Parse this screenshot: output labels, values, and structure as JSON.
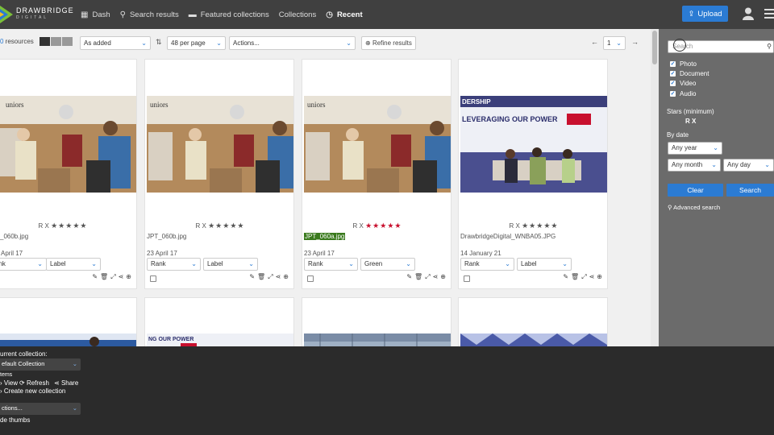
{
  "header": {
    "logo_text": "DRAWBRIDGE",
    "logo_sub": "DIGITAL",
    "nav": [
      {
        "label": "Dash",
        "icon": "grid-icon"
      },
      {
        "label": "Search results",
        "icon": "search-icon"
      },
      {
        "label": "Featured collections",
        "icon": "folder-icon"
      },
      {
        "label": "Collections",
        "icon": ""
      },
      {
        "label": "Recent",
        "icon": "clock-icon"
      }
    ],
    "upload_label": "Upload"
  },
  "toolbar": {
    "resource_count": "0",
    "resource_label": " resources",
    "sort_select": "As added",
    "per_page_select": "48 per page",
    "actions_select": "Actions...",
    "refine_label": "Refine results",
    "page_number": "1"
  },
  "cards": [
    {
      "rating_prefix": "R X",
      "filename": "_060b.jpg",
      "date": "April 17",
      "rank": "ank",
      "label": "Label",
      "highlight": false,
      "red_stars": false
    },
    {
      "rating_prefix": "R X",
      "filename": "JPT_060b.jpg",
      "date": "23 April 17",
      "rank": "Rank",
      "label": "Label",
      "highlight": false,
      "red_stars": false
    },
    {
      "rating_prefix": "R X",
      "filename": "JPT_060a.jpg",
      "date": "23 April 17",
      "rank": "Rank",
      "label": "Green",
      "highlight": true,
      "red_stars": true
    },
    {
      "rating_prefix": "R X",
      "filename": "DrawbridgeDigital_WNBA05.JPG",
      "date": "14 January 21",
      "rank": "Rank",
      "label": "Label",
      "highlight": false,
      "red_stars": false
    }
  ],
  "thumb_text": {
    "store_sign": "uniors",
    "banner_top": "DERSHIP",
    "banner_main": "LEVERAGING OUR POWER",
    "banner_row2": "NG OUR POWER"
  },
  "panel": {
    "search_placeholder": "Search",
    "types": [
      "Photo",
      "Document",
      "Video",
      "Audio"
    ],
    "stars_label": "Stars (minimum)",
    "stars_rx": "R  X",
    "by_date_label": "By date",
    "any_year": "Any year",
    "any_month": "Any month",
    "any_day": "Any day",
    "clear_label": "Clear",
    "search_label": "Search",
    "advanced_label": "Advanced search"
  },
  "bottom": {
    "current_collection_label": "urrent collection:",
    "collection_select": "efault Collection",
    "items_label": "tems",
    "view_label": "View",
    "refresh_label": "Refresh",
    "share_label": "Share",
    "create_label": "Create new collection",
    "actions_select": "ctions...",
    "hide_thumbs": "de thumbs"
  },
  "colors": {
    "accent": "#2b7bd3",
    "header": "#404040",
    "panel": "#6b6b6b",
    "bottom": "#2b2b2b",
    "highlight": "#3a7a1d",
    "star_red": "#c8102e"
  }
}
